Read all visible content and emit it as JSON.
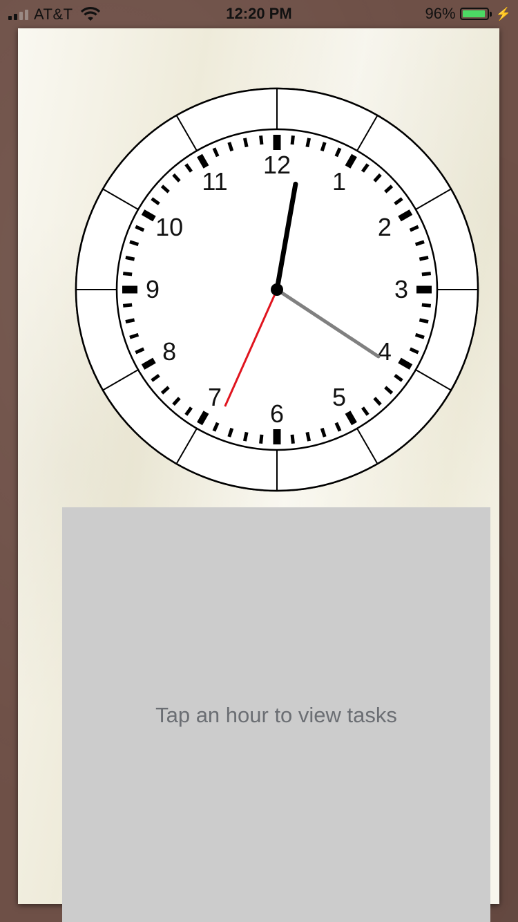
{
  "status_bar": {
    "carrier": "AT&T",
    "time": "12:20 PM",
    "battery_percent": "96%",
    "battery_level": 0.96,
    "signal_bars": 2,
    "signal_bars_total": 4,
    "icons": [
      "signal-icon",
      "wifi-icon",
      "battery-icon",
      "charging-bolt-icon"
    ]
  },
  "clock": {
    "numbers": [
      "12",
      "1",
      "2",
      "3",
      "4",
      "5",
      "6",
      "7",
      "8",
      "9",
      "10",
      "11"
    ],
    "hour_segments": 12,
    "time": {
      "hours": 12,
      "minutes": 20,
      "seconds": 34
    },
    "colors": {
      "hour_hand": "#000000",
      "minute_hand": "#808080",
      "second_hand": "#e0141e",
      "face": "#ffffff",
      "ticks": "#000000"
    }
  },
  "tasks": {
    "hint": "Tap an hour to view tasks",
    "panel_color": "#cccccc"
  }
}
